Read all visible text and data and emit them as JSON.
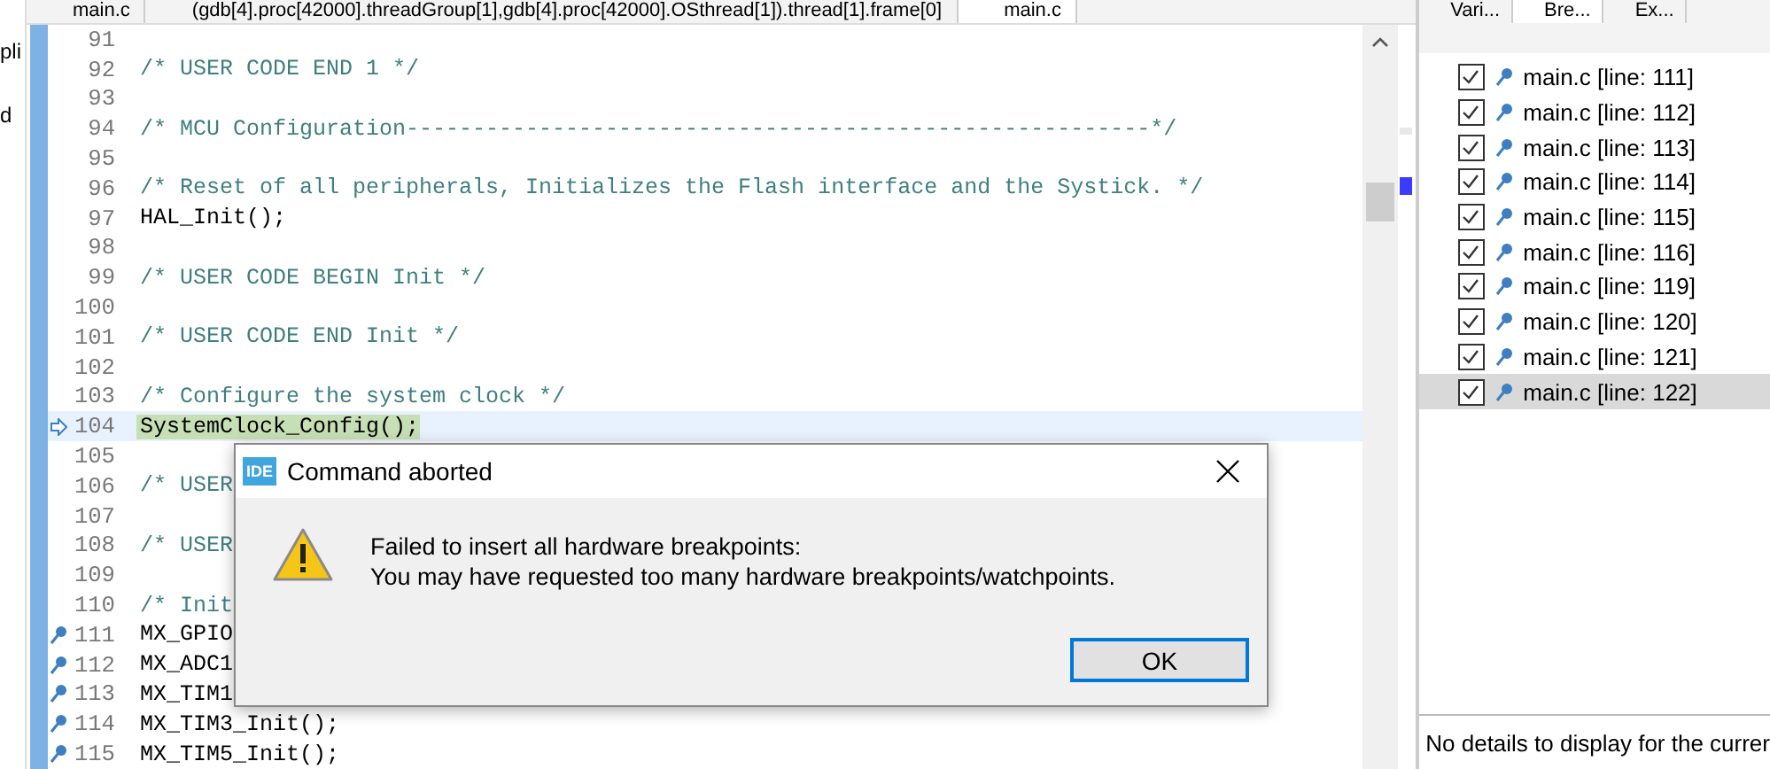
{
  "left_panel": {
    "fragments": [
      "pli",
      "d"
    ]
  },
  "editor": {
    "tabs": [
      {
        "label": "main.c",
        "selected": false
      },
      {
        "label": "(gdb[4].proc[42000].threadGroup[1],gdb[4].proc[42000].OSthread[1]).thread[1].frame[0]",
        "selected": false
      },
      {
        "label": "main.c",
        "selected": true
      }
    ],
    "lines": [
      {
        "number": "91"
      },
      {
        "number": "92",
        "text": "/* USER CODE END 1 */",
        "kind": "comment"
      },
      {
        "number": "93"
      },
      {
        "number": "94",
        "text": "/* MCU Configuration--------------------------------------------------------*/",
        "kind": "comment"
      },
      {
        "number": "95"
      },
      {
        "number": "96",
        "text": "/* Reset of all peripherals, Initializes the Flash interface and the Systick. */",
        "kind": "comment"
      },
      {
        "number": "97",
        "text": "HAL_Init();",
        "kind": "code"
      },
      {
        "number": "98"
      },
      {
        "number": "99",
        "text": "/* USER CODE BEGIN Init */",
        "kind": "comment"
      },
      {
        "number": "100"
      },
      {
        "number": "101",
        "text": "/* USER CODE END Init */",
        "kind": "comment"
      },
      {
        "number": "102"
      },
      {
        "number": "103",
        "text": "/* Configure the system clock */",
        "kind": "comment"
      },
      {
        "number": "104",
        "text": "SystemClock_Config();",
        "kind": "code",
        "current": true
      },
      {
        "number": "105"
      },
      {
        "number": "106",
        "text": "/* USER",
        "kind": "comment"
      },
      {
        "number": "107"
      },
      {
        "number": "108",
        "text": "/* USER",
        "kind": "comment"
      },
      {
        "number": "109"
      },
      {
        "number": "110",
        "text": "/* Init",
        "kind": "comment"
      },
      {
        "number": "111",
        "text": "MX_GPIO",
        "kind": "code",
        "breakpoint": true
      },
      {
        "number": "112",
        "text": "MX_ADC1",
        "kind": "code",
        "breakpoint": true
      },
      {
        "number": "113",
        "text": "MX_TIM1",
        "kind": "code",
        "breakpoint": true
      },
      {
        "number": "114",
        "text": "MX_TIM3_Init();",
        "kind": "code",
        "breakpoint": true
      },
      {
        "number": "115",
        "text": "MX_TIM5_Init();",
        "kind": "code",
        "breakpoint": true
      }
    ]
  },
  "dialog": {
    "app_badge": "IDE",
    "title": "Command aborted",
    "message_lines": [
      "Failed to insert all hardware breakpoints:",
      "You may have requested too many hardware breakpoints/watchpoints."
    ],
    "button": "OK"
  },
  "breakpoints_panel": {
    "tabs": [
      {
        "label": "Vari...",
        "selected": false
      },
      {
        "label": "Bre...",
        "selected": true
      },
      {
        "label": "Ex...",
        "selected": false
      }
    ],
    "items": [
      {
        "label": "main.c [line: 111]",
        "checked": true,
        "selected": false
      },
      {
        "label": "main.c [line: 112]",
        "checked": true,
        "selected": false
      },
      {
        "label": "main.c [line: 113]",
        "checked": true,
        "selected": false
      },
      {
        "label": "main.c [line: 114]",
        "checked": true,
        "selected": false
      },
      {
        "label": "main.c [line: 115]",
        "checked": true,
        "selected": false
      },
      {
        "label": "main.c [line: 116]",
        "checked": true,
        "selected": false
      },
      {
        "label": "main.c [line: 119]",
        "checked": true,
        "selected": false
      },
      {
        "label": "main.c [line: 120]",
        "checked": true,
        "selected": false
      },
      {
        "label": "main.c [line: 121]",
        "checked": true,
        "selected": false
      },
      {
        "label": "main.c [line: 122]",
        "checked": true,
        "selected": true
      }
    ],
    "details": "No details to display for the currer"
  }
}
